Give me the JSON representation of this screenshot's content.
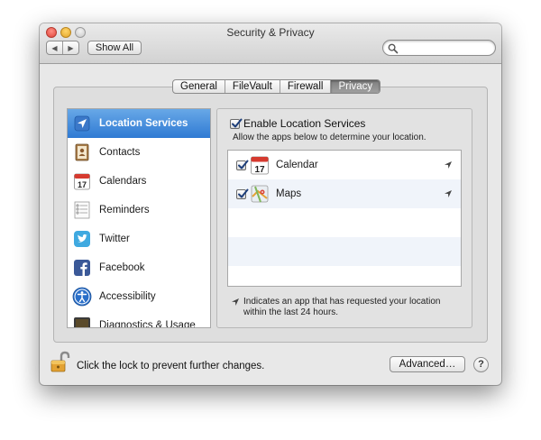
{
  "window": {
    "title": "Security & Privacy"
  },
  "toolbar": {
    "back_label": "◀",
    "forward_label": "▶",
    "show_all_label": "Show All",
    "search_placeholder": ""
  },
  "tabs": [
    {
      "label": "General",
      "active": false
    },
    {
      "label": "FileVault",
      "active": false
    },
    {
      "label": "Firewall",
      "active": false
    },
    {
      "label": "Privacy",
      "active": true
    }
  ],
  "sidebar": {
    "items": [
      {
        "label": "Location Services",
        "icon": "location-arrow-icon",
        "selected": true
      },
      {
        "label": "Contacts",
        "icon": "contacts-icon",
        "selected": false
      },
      {
        "label": "Calendars",
        "icon": "calendar-icon",
        "selected": false
      },
      {
        "label": "Reminders",
        "icon": "reminders-icon",
        "selected": false
      },
      {
        "label": "Twitter",
        "icon": "twitter-icon",
        "selected": false
      },
      {
        "label": "Facebook",
        "icon": "facebook-icon",
        "selected": false
      },
      {
        "label": "Accessibility",
        "icon": "accessibility-icon",
        "selected": false
      },
      {
        "label": "Diagnostics & Usage",
        "icon": "diagnostics-icon",
        "selected": false
      }
    ]
  },
  "location": {
    "enable_label": "Enable Location Services",
    "enabled": true,
    "description": "Allow the apps below to determine your location.",
    "apps": [
      {
        "name": "Calendar",
        "checked": true,
        "icon": "calendar-app-icon",
        "recent": true
      },
      {
        "name": "Maps",
        "checked": true,
        "icon": "maps-app-icon",
        "recent": true
      }
    ],
    "legend": "Indicates an app that has requested your location within the last 24 hours."
  },
  "footer": {
    "lock_text": "Click the lock to prevent further changes.",
    "advanced_label": "Advanced…",
    "help_label": "?"
  },
  "calendar_icon_day": "17",
  "colors": {
    "selection": "#3a83d6",
    "window_bg": "#e8e8e8",
    "close": "#e0443a",
    "minimize": "#e2a52a"
  }
}
